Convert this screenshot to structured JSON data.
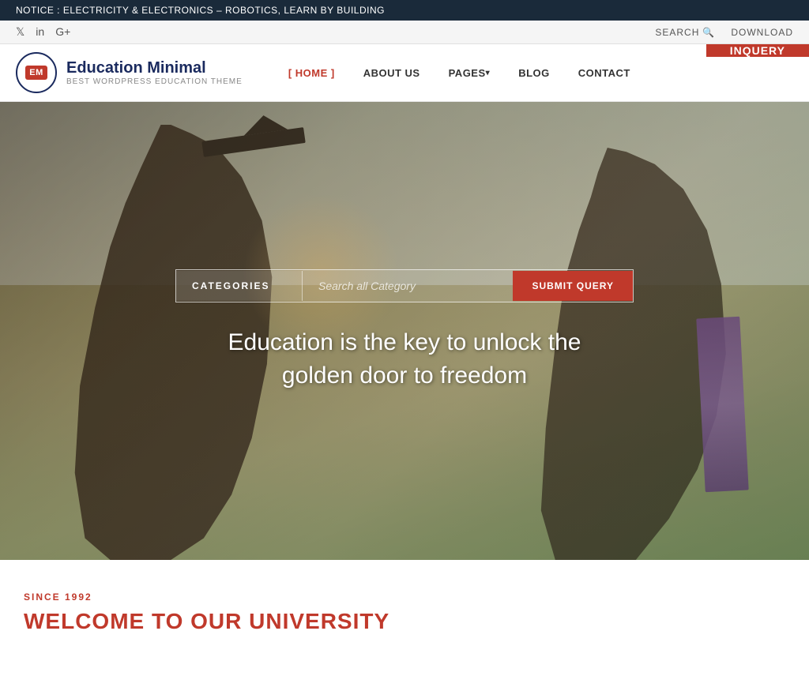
{
  "notice": {
    "text": "NOTICE :  ELECTRICITY & ELECTRONICS – ROBOTICS, LEARN BY BUILDING"
  },
  "topbar": {
    "social": {
      "twitter": "𝕏",
      "linkedin": "in",
      "googleplus": "G+"
    },
    "search_label": "SEARCH",
    "download_label": "DOWNLOAD"
  },
  "header": {
    "logo": {
      "badge": "EM",
      "name": "Education Minimal",
      "tagline": "BEST WORDPRESS EDUCATION THEME"
    },
    "nav": [
      {
        "label": "[ HOME ]",
        "id": "home",
        "active": true
      },
      {
        "label": "ABOUT US",
        "id": "about"
      },
      {
        "label": "PAGES",
        "id": "pages",
        "dropdown": true
      },
      {
        "label": "BLOG",
        "id": "blog"
      },
      {
        "label": "CONTACT",
        "id": "contact"
      }
    ],
    "inquiry_label": "INQUERY"
  },
  "hero": {
    "search": {
      "categories_label": "CATEGORIES",
      "placeholder": "Search all Category",
      "submit_label": "SUBMIT QUERY"
    },
    "quote": "Education is the key to unlock the golden door to freedom"
  },
  "below": {
    "since_label": "SINCE 1992",
    "welcome_heading": "WELCOME TO OUR UNIVERSITY"
  }
}
